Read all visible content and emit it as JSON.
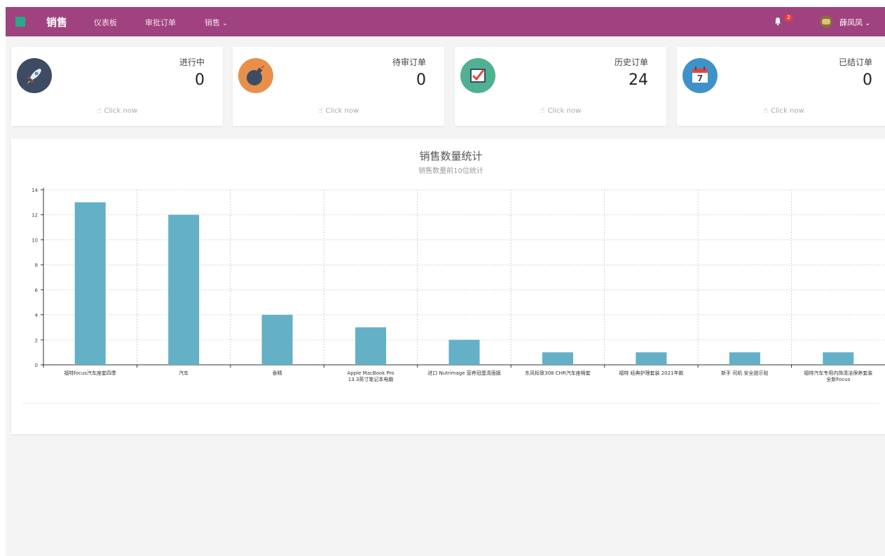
{
  "header": {
    "brand": "销售",
    "nav": [
      "仪表板",
      "审批订单",
      "销售"
    ],
    "notification_count": "2",
    "user_name": "薛凤凤"
  },
  "cards": [
    {
      "label": "进行中",
      "value": "0",
      "link": "Click now",
      "color": "#3d4c63",
      "icon": "rocket-icon"
    },
    {
      "label": "待审订单",
      "value": "0",
      "link": "Click now",
      "color": "#e8904a",
      "icon": "bomb-icon"
    },
    {
      "label": "历史订单",
      "value": "24",
      "link": "Click now",
      "color": "#4fb092",
      "icon": "checklist-icon"
    },
    {
      "label": "已结订单",
      "value": "0",
      "link": "Click now",
      "color": "#3f92c9",
      "icon": "calendar-icon"
    }
  ],
  "calendar_day": "7",
  "chart_data": {
    "type": "bar",
    "title": "销售数量统计",
    "subtitle": "销售数量前10位统计",
    "categories": [
      "福特focus汽车座套四季",
      "汽车",
      "香精",
      "Apple MacBook Pro 13.3英寸笔记本电脑",
      "进口 Nutrimage 营养冠蛋清面膜",
      "东风标致308 CHR汽车座椅套",
      "福特 经典护理套装 2021年款",
      "新手 司机 安全提示贴",
      "福特汽车专用内饰清洁保养套装 全新Focus"
    ],
    "values": [
      13,
      12,
      4,
      3,
      2,
      1,
      1,
      1,
      1
    ],
    "ylim": [
      0,
      14
    ],
    "yticks": [
      0,
      2,
      4,
      6,
      8,
      10,
      12,
      14
    ],
    "bar_color": "#63b0c7",
    "grid": true
  }
}
